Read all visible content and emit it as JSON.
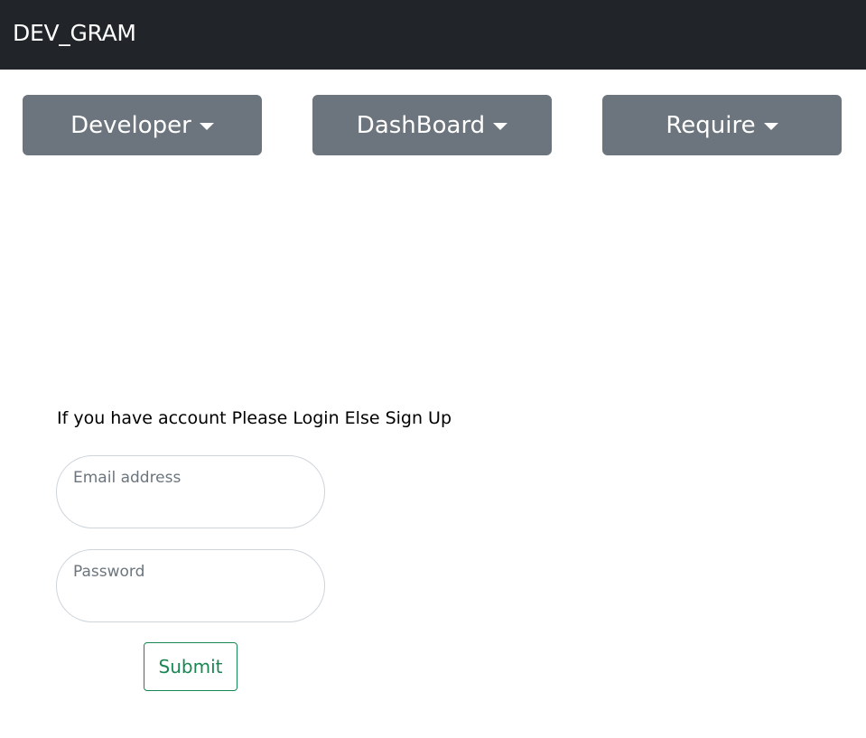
{
  "navbar": {
    "brand": "DEV_GRAM",
    "background_color": "#212529"
  },
  "dropdowns": [
    {
      "label": "Developer",
      "icon": "caret-down-icon"
    },
    {
      "label": "DashBoard",
      "icon": "caret-down-icon"
    },
    {
      "label": "Require",
      "icon": "caret-down-icon"
    }
  ],
  "dropdown_color": "#6c757d",
  "login": {
    "prompt": "If you have account Please Login Else Sign Up",
    "email_label": "Email address",
    "email_value": "",
    "password_label": "Password",
    "password_value": "",
    "submit_label": "Submit",
    "submit_color": "#198754"
  }
}
